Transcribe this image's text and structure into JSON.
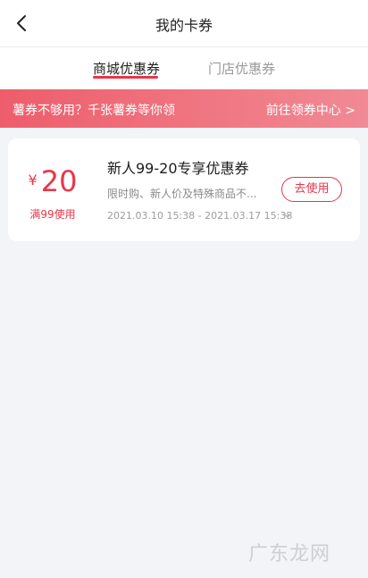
{
  "header": {
    "title": "我的卡券",
    "back_icon": "chevron-left-icon"
  },
  "tabs": [
    {
      "label": "商城优惠券",
      "active": true
    },
    {
      "label": "门店优惠券",
      "active": false
    }
  ],
  "banner": {
    "text": "薯券不够用？千张薯券等你领",
    "link": "前往领券中心 >"
  },
  "coupon": {
    "currency": "¥",
    "value": "20",
    "threshold": "满99使用",
    "title": "新人99-20专享优惠券",
    "description": "限时购、新人价及特殊商品不...",
    "time_range": "2021.03.10 15:38 - 2021.03.17 15:38",
    "expand_icon": "chevron-down-icon",
    "action_label": "去使用"
  },
  "watermark": "广东龙网",
  "colors": {
    "accent": "#e8364a",
    "banner_start": "#ee5d6b",
    "banner_end": "#f08a94",
    "background": "#f3f4f8"
  }
}
